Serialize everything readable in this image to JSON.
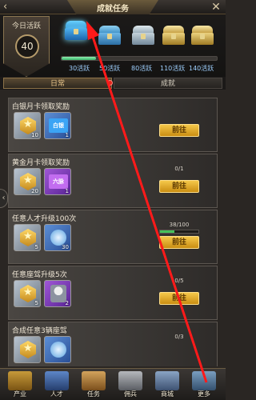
{
  "header": {
    "title": "成就任务"
  },
  "activity": {
    "today_label": "今日活跃",
    "today_value": "40",
    "progress_fraction": 0.22,
    "milestones": [
      "30活跃",
      "50活跃",
      "80活跃",
      "110活跃",
      "140活跃"
    ]
  },
  "tabs": [
    {
      "label": "日常"
    },
    {
      "label": "成就"
    }
  ],
  "tasks": [
    {
      "title": "白银月卡领取奖励",
      "rewards": [
        {
          "icon": "medal-icon",
          "count": "10"
        },
        {
          "icon": "silver-card-icon",
          "count": "1",
          "text": "白银"
        }
      ],
      "progress": "",
      "fraction": 0,
      "button": "前往"
    },
    {
      "title": "黄金月卡领取奖励",
      "rewards": [
        {
          "icon": "medal-icon",
          "count": "20"
        },
        {
          "icon": "gold-card-icon",
          "count": "1",
          "text": "六脉"
        }
      ],
      "progress": "0/1",
      "fraction": 0,
      "button": "前往"
    },
    {
      "title": "任意人才升级100次",
      "rewards": [
        {
          "icon": "medal-icon",
          "count": "5"
        },
        {
          "icon": "book-icon",
          "count": "30"
        }
      ],
      "progress": "38/100",
      "fraction": 0.38,
      "button": "前往"
    },
    {
      "title": "任意座驾升级5次",
      "rewards": [
        {
          "icon": "medal-icon",
          "count": "5"
        },
        {
          "icon": "avatar-icon",
          "count": "2"
        }
      ],
      "progress": "0/5",
      "fraction": 0,
      "button": "前往"
    },
    {
      "title": "合成任意3辆座驾",
      "rewards": [
        {
          "icon": "medal-icon",
          "count": ""
        },
        {
          "icon": "book-icon",
          "count": ""
        }
      ],
      "progress": "0/3",
      "fraction": 0,
      "button": "前往"
    }
  ],
  "bottom_nav": [
    {
      "label": "产业",
      "icon": "industry-icon"
    },
    {
      "label": "人才",
      "icon": "talent-icon"
    },
    {
      "label": "任务",
      "icon": "task-icon"
    },
    {
      "label": "佣兵",
      "icon": "mercenary-icon"
    },
    {
      "label": "商城",
      "icon": "shop-icon"
    },
    {
      "label": "更多",
      "icon": "more-icon"
    }
  ]
}
